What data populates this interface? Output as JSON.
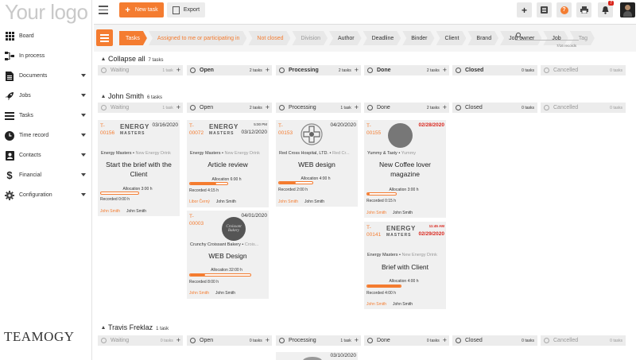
{
  "app": {
    "logo_text": "Your logo",
    "brand": "TEAMOGY"
  },
  "sidebar": {
    "items": [
      {
        "label": "Board",
        "icon": "grid-icon",
        "caret": false
      },
      {
        "label": "In process",
        "icon": "flow-icon",
        "caret": false
      },
      {
        "label": "Documents",
        "icon": "document-icon",
        "caret": true
      },
      {
        "label": "Jobs",
        "icon": "rocket-icon",
        "caret": true
      },
      {
        "label": "Tasks",
        "icon": "tasks-icon",
        "caret": true
      },
      {
        "label": "Time record",
        "icon": "clock-icon",
        "caret": true
      },
      {
        "label": "Contacts",
        "icon": "contacts-icon",
        "caret": true
      },
      {
        "label": "Financial",
        "icon": "dollar-icon",
        "caret": true
      },
      {
        "label": "Configuration",
        "icon": "gear-icon",
        "caret": true
      }
    ]
  },
  "toolbar": {
    "new_task": "New task",
    "export": "Export",
    "notification_count": "7"
  },
  "filters": {
    "chips": [
      "Tasks",
      "Assigned to me or participating in",
      "Not closed",
      "Division",
      "Author",
      "Deadline",
      "Binder",
      "Client",
      "Brand",
      "Job owner",
      "Job",
      "Tag"
    ],
    "records": "7/16 records",
    "search_placeholder": ""
  },
  "groups": {
    "collapse": {
      "label": "Collapse all",
      "count": "7 tasks"
    },
    "john": {
      "label": "John Smith",
      "count": "6 tasks"
    },
    "travis": {
      "label": "Travis Freklaz",
      "count": "1 task"
    }
  },
  "columns": {
    "collapse": [
      {
        "name": "Waiting",
        "count": "1 task"
      },
      {
        "name": "Open",
        "count": "2 tasks"
      },
      {
        "name": "Processing",
        "count": "2 tasks"
      },
      {
        "name": "Done",
        "count": "2 tasks"
      },
      {
        "name": "Closed",
        "count": "0 tasks"
      },
      {
        "name": "Cancelled",
        "count": "0 tasks"
      }
    ],
    "john": [
      {
        "name": "Waiting",
        "count": "1 task"
      },
      {
        "name": "Open",
        "count": "2 tasks"
      },
      {
        "name": "Processing",
        "count": "1 task"
      },
      {
        "name": "Done",
        "count": "2 tasks"
      },
      {
        "name": "Closed",
        "count": "0 tasks"
      },
      {
        "name": "Cancelled",
        "count": "0 tasks"
      }
    ],
    "travis": [
      {
        "name": "Waiting",
        "count": "0 tasks"
      },
      {
        "name": "Open",
        "count": "0 tasks"
      },
      {
        "name": "Processing",
        "count": "1 task"
      },
      {
        "name": "Done",
        "count": "0 tasks"
      },
      {
        "name": "Closed",
        "count": "0 tasks"
      },
      {
        "name": "Cancelled",
        "count": "0 tasks"
      }
    ]
  },
  "cards": {
    "c156": {
      "id1": "T-",
      "id2": "00156",
      "date": "03/16/2020",
      "client": "Energy Masters",
      "brand": "New Energy Drink",
      "title": "Start the brief with the Client",
      "alloc": "Allocation 3:00 h",
      "rec": "Recorded 0:00 h",
      "p1": "John Smith",
      "p2": "John Smith",
      "progress": 0
    },
    "c72": {
      "id1": "T-",
      "id2": "00072",
      "time": "5:00 PM",
      "date": "03/12/2020",
      "client": "Energy Masters",
      "brand": "New Energy Drink",
      "title": "Article review",
      "alloc": "Allocation 6:00 h",
      "rec": "Recorded 4:15 h",
      "p1": "Libor Černý",
      "p2": "John Smith",
      "progress": 0.7
    },
    "c153": {
      "id1": "T-",
      "id2": "00153",
      "date": "04/20/2020",
      "client": "Red Cross Hospital, LTD.",
      "brand": "Red Cr...",
      "title": "WEB design",
      "alloc": "Allocation 4:00 h",
      "rec": "Recorded 2:00 h",
      "p1": "John Smith",
      "p2": "John Smith",
      "progress": 0.5
    },
    "c155": {
      "id1": "T-",
      "id2": "00155",
      "date": "02/28/2020",
      "client": "Yummy & Tasty",
      "brand": "Yummy",
      "title": "New Coffee lover magazine",
      "alloc": "Allocation 3:00 h",
      "rec": "Recorded 0:15 h",
      "p1": "John Smith",
      "p2": "John Smith",
      "progress": 0.08
    },
    "c3": {
      "id1": "T-",
      "id2": "00003",
      "date": "04/01/2020",
      "client": "Crunchy Croissant Bakery",
      "brand": "Crois...",
      "title": "WEB Design",
      "alloc": "Allocation 32:00 h",
      "rec": "Recorded 8:00 h",
      "p1": "John Smith",
      "p2": "John Smith",
      "progress": 0.25
    },
    "c141": {
      "id1": "T-",
      "id2": "00141",
      "time": "11:45 AM",
      "date": "02/29/2020",
      "client": "Energy Masters",
      "brand": "New Energy Drink",
      "title": "Brief with Client",
      "alloc": "Allocation 4:00 h",
      "rec": "Recorded 4:00 h",
      "p1": "John Smith",
      "p2": "John Smith",
      "progress": 1.0
    },
    "travis_date": "03/10/2020"
  },
  "logos": {
    "energy_top": "ENERGY",
    "energy_bottom": "MASTERS",
    "croissant": "Croissant Bakery"
  },
  "colors": {
    "accent": "#f47c30",
    "danger": "#d9251c",
    "card_bg": "#f0f0f0"
  }
}
